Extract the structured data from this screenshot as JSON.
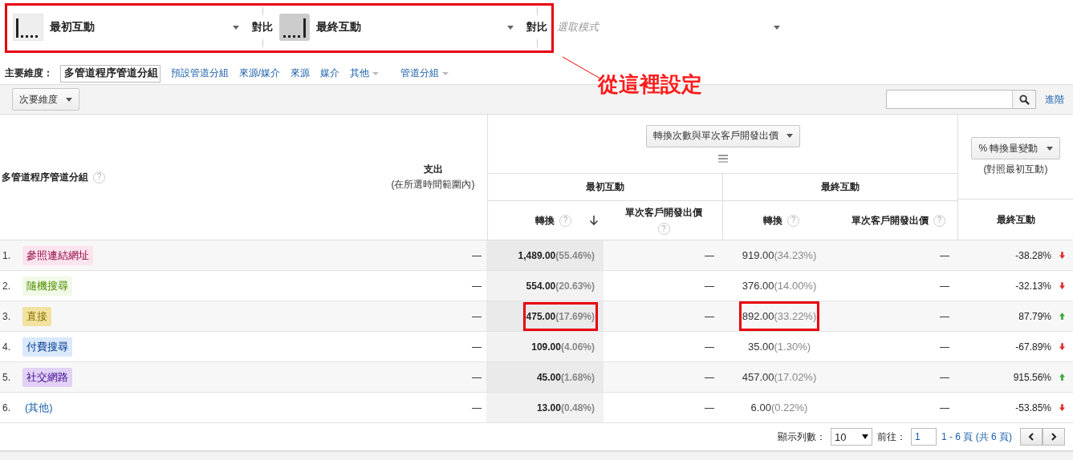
{
  "model_bar": {
    "models": [
      {
        "kind": "first",
        "label": "最初互動"
      },
      {
        "kind": "last",
        "label": "最終互動",
        "compare_label": "對比"
      },
      {
        "kind": "empty",
        "placeholder": "選取模式",
        "compare_label": "對比"
      }
    ],
    "annotation": "從這裡設定"
  },
  "dimensions": {
    "label": "主要維度：",
    "items": [
      {
        "label": "多管道程序管道分組",
        "selected": true,
        "has_menu": false
      },
      {
        "label": "預設管道分組",
        "selected": false,
        "has_menu": false
      },
      {
        "label": "來源/媒介",
        "selected": false,
        "has_menu": false
      },
      {
        "label": "來源",
        "selected": false,
        "has_menu": false
      },
      {
        "label": "媒介",
        "selected": false,
        "has_menu": false
      },
      {
        "label": "其他",
        "selected": false,
        "has_menu": true
      },
      {
        "label": "管道分組",
        "selected": false,
        "has_menu": true
      }
    ]
  },
  "toolbar": {
    "secondary_dimension": "次要維度",
    "advanced_link": "進階"
  },
  "table": {
    "dimension_header": {
      "label": "多管道程序管道分組",
      "help": "?"
    },
    "spend_header": "支出",
    "spend_note": "(在所選時間範圍內)",
    "metric_select": "轉換次數與單次客戶開發出價",
    "first_group": "最初互動",
    "last_group": "最終互動",
    "sub_headers": [
      {
        "label": "轉換",
        "help": "?",
        "sorted": true
      },
      {
        "label": "單次客戶開發出價",
        "help": "?",
        "sorted": false
      },
      {
        "label": "轉換",
        "help": "?",
        "sorted": false
      },
      {
        "label": "單次客戶開發出價",
        "help": "?",
        "sorted": false
      }
    ],
    "change_select": "% 轉換量變動",
    "change_note": "(對照最初互動)",
    "change_header": "最終互動",
    "rows": [
      {
        "index": "1.",
        "channel": "參照連結網址",
        "color": "#fce4ef",
        "spend": "—",
        "first_conv": "1,489.00",
        "first_pct": "(55.46%)",
        "first_cpa": "—",
        "last_conv": "919.00",
        "last_pct": "(34.23%)",
        "last_cpa": "—",
        "change": "-38.28%",
        "rising": false,
        "highlighted": false
      },
      {
        "index": "2.",
        "channel": "隨機搜尋",
        "color": "#f1fae6",
        "spend": "—",
        "first_conv": "554.00",
        "first_pct": "(20.63%)",
        "first_cpa": "—",
        "last_conv": "376.00",
        "last_pct": "(14.00%)",
        "last_cpa": "—",
        "change": "-32.13%",
        "rising": false,
        "highlighted": false
      },
      {
        "index": "3.",
        "channel": "直接",
        "color": "#f2e2a0",
        "spend": "—",
        "first_conv": "475.00",
        "first_pct": "(17.69%)",
        "first_cpa": "—",
        "last_conv": "892.00",
        "last_pct": "(33.22%)",
        "last_cpa": "—",
        "change": "87.79%",
        "rising": true,
        "highlighted": true
      },
      {
        "index": "4.",
        "channel": "付費搜尋",
        "color": "#dbe9fd",
        "spend": "—",
        "first_conv": "109.00",
        "first_pct": "(4.06%)",
        "first_cpa": "—",
        "last_conv": "35.00",
        "last_pct": "(1.30%)",
        "last_cpa": "—",
        "change": "-67.89%",
        "rising": false,
        "highlighted": false
      },
      {
        "index": "5.",
        "channel": "社交網路",
        "color": "#e1d2f6",
        "spend": "—",
        "first_conv": "45.00",
        "first_pct": "(1.68%)",
        "first_cpa": "—",
        "last_conv": "457.00",
        "last_pct": "(17.02%)",
        "last_cpa": "—",
        "change": "915.56%",
        "rising": true,
        "highlighted": false
      },
      {
        "index": "6.",
        "channel": "(其他)",
        "spend": "—",
        "first_conv": "13.00",
        "first_pct": "(0.48%)",
        "first_cpa": "—",
        "last_conv": "6.00",
        "last_pct": "(0.22%)",
        "last_cpa": "—",
        "change": "-53.85%",
        "rising": false,
        "highlighted": false
      }
    ]
  },
  "pagination": {
    "rows_label": "顯示列數：",
    "rows_value": "10",
    "goto_label": "前往：",
    "goto_value": "1",
    "range": "1 - 6 頁 (共 6 頁)"
  }
}
